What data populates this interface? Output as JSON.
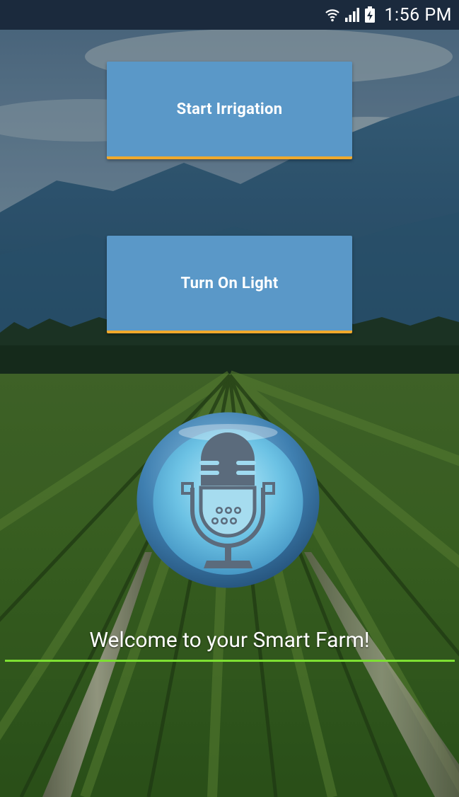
{
  "status_bar": {
    "time": "1:56 PM",
    "icons": [
      "wifi-icon",
      "signal-icon",
      "battery-charging-icon"
    ]
  },
  "buttons": {
    "irrigation_label": "Start Irrigation",
    "light_label": "Turn On Light"
  },
  "voice_button": {
    "icon": "microphone-icon"
  },
  "welcome_text": "Welcome to your Smart Farm!",
  "colors": {
    "status_bar": "#1b2a3d",
    "button_fill": "#5a98c8",
    "button_border": "#f0a92c",
    "underline": "#7ee032",
    "mic_glow": "#7fd3ef",
    "mic_body": "#5b6b7c"
  }
}
